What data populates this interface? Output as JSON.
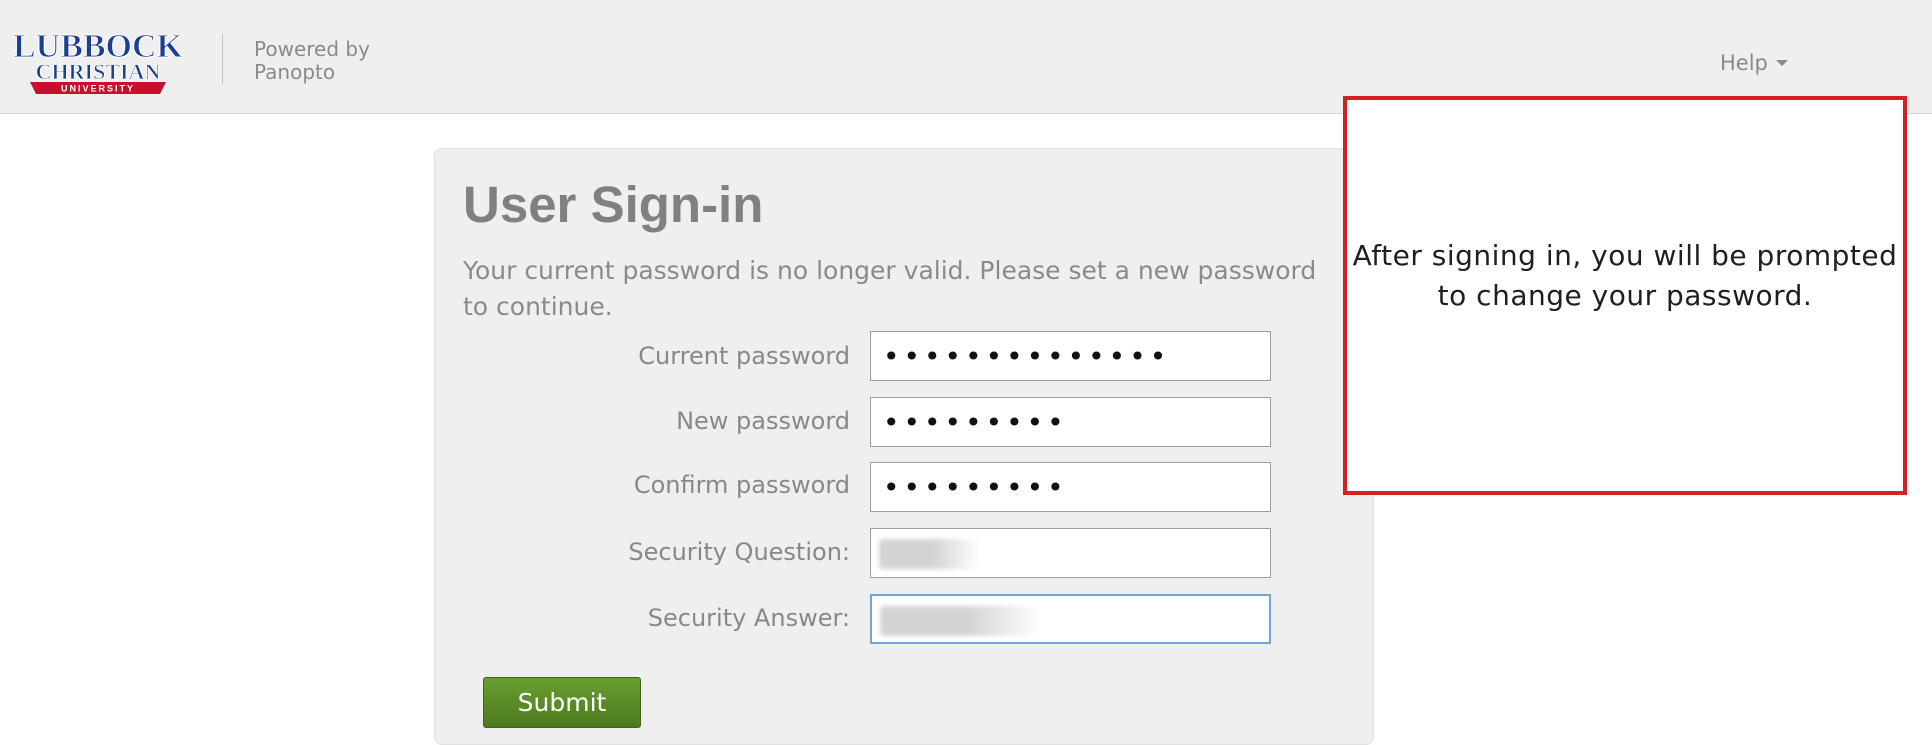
{
  "header": {
    "logo": {
      "line1": "LUBBOCK",
      "line2": "CHRISTIAN",
      "line3": "UNIVERSITY"
    },
    "powered_by": "Powered by",
    "provider": "Panopto",
    "help_label": "Help"
  },
  "form": {
    "title": "User Sign-in",
    "message": "Your current password is no longer valid. Please set a new password to continue.",
    "fields": [
      {
        "label": "Current password",
        "value": "••••••••••••••"
      },
      {
        "label": "New password",
        "value": "•••••••••"
      },
      {
        "label": "Confirm password",
        "value": "•••••••••"
      },
      {
        "label": "Security Question:",
        "value": ""
      },
      {
        "label": "Security Answer:",
        "value": ""
      }
    ],
    "submit_label": "Submit"
  },
  "callout": {
    "text": "After signing in, you will be prompted to change your password."
  },
  "colors": {
    "header_bg": "#efefef",
    "panel_bg": "#efefef",
    "submit_green": "#5a8d28",
    "callout_border": "#d51f26",
    "logo_navy": "#1d3f91",
    "logo_red": "#c8102e"
  }
}
